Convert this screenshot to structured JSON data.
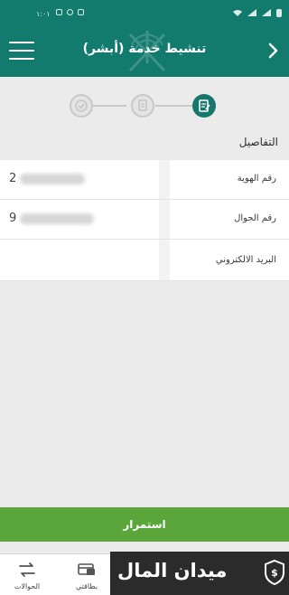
{
  "status_bar": {
    "time": "١:٠١"
  },
  "header": {
    "title": "تنشيط خدمة (أبشر)"
  },
  "stepper": {
    "steps": [
      {
        "state": "active",
        "icon": "edit-document-icon"
      },
      {
        "state": "inactive",
        "icon": "document-icon"
      },
      {
        "state": "inactive",
        "icon": "check-circle-icon"
      }
    ]
  },
  "form": {
    "section_title": "التفاصيل",
    "fields": [
      {
        "label": "رقم الهوية",
        "value": "2"
      },
      {
        "label": "رقم الجوال",
        "value": "9"
      },
      {
        "label": "البريد الالكتروني",
        "value": ""
      }
    ]
  },
  "actions": {
    "continue_label": "استمرار"
  },
  "bottom_nav": [
    {
      "label": "الحوالات",
      "icon": "transfer-icon"
    },
    {
      "label": "بطاقتي",
      "icon": "card-icon"
    }
  ],
  "brand": {
    "name": "ميدان المال",
    "icon": "shield-dollar-icon"
  },
  "colors": {
    "primary": "#137a6e",
    "continue": "#5ba63b",
    "background": "#ebebeb"
  }
}
